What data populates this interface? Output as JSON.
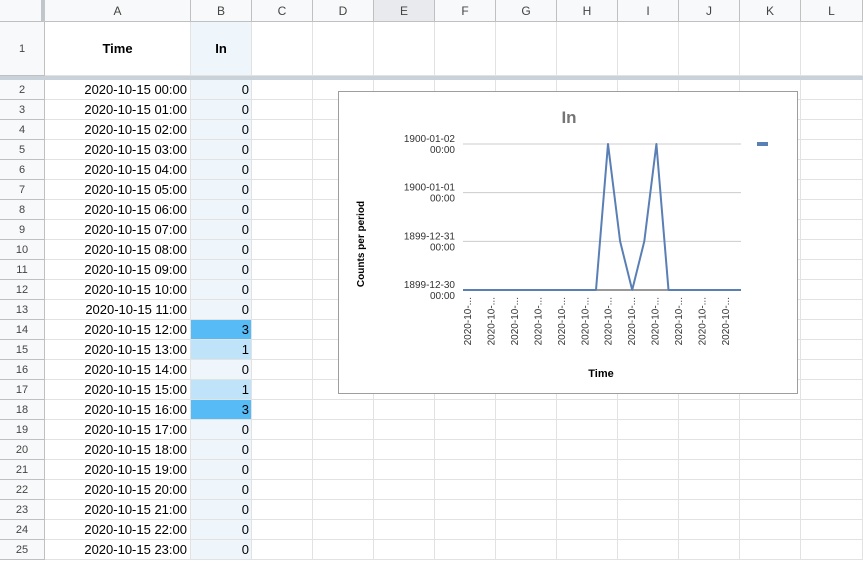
{
  "columns": [
    "A",
    "B",
    "C",
    "D",
    "E",
    "F",
    "G",
    "H",
    "I",
    "J",
    "K",
    "L"
  ],
  "header_row": {
    "row": "1",
    "time": "Time",
    "in": "In"
  },
  "rows": [
    {
      "row": "2",
      "time": "2020-10-15 00:00",
      "in": "0"
    },
    {
      "row": "3",
      "time": "2020-10-15 01:00",
      "in": "0"
    },
    {
      "row": "4",
      "time": "2020-10-15 02:00",
      "in": "0"
    },
    {
      "row": "5",
      "time": "2020-10-15 03:00",
      "in": "0"
    },
    {
      "row": "6",
      "time": "2020-10-15 04:00",
      "in": "0"
    },
    {
      "row": "7",
      "time": "2020-10-15 05:00",
      "in": "0"
    },
    {
      "row": "8",
      "time": "2020-10-15 06:00",
      "in": "0"
    },
    {
      "row": "9",
      "time": "2020-10-15 07:00",
      "in": "0"
    },
    {
      "row": "10",
      "time": "2020-10-15 08:00",
      "in": "0"
    },
    {
      "row": "11",
      "time": "2020-10-15 09:00",
      "in": "0"
    },
    {
      "row": "12",
      "time": "2020-10-15 10:00",
      "in": "0"
    },
    {
      "row": "13",
      "time": "2020-10-15 11:00",
      "in": "0"
    },
    {
      "row": "14",
      "time": "2020-10-15 12:00",
      "in": "3"
    },
    {
      "row": "15",
      "time": "2020-10-15 13:00",
      "in": "1"
    },
    {
      "row": "16",
      "time": "2020-10-15 14:00",
      "in": "0"
    },
    {
      "row": "17",
      "time": "2020-10-15 15:00",
      "in": "1"
    },
    {
      "row": "18",
      "time": "2020-10-15 16:00",
      "in": "3"
    },
    {
      "row": "19",
      "time": "2020-10-15 17:00",
      "in": "0"
    },
    {
      "row": "20",
      "time": "2020-10-15 18:00",
      "in": "0"
    },
    {
      "row": "21",
      "time": "2020-10-15 19:00",
      "in": "0"
    },
    {
      "row": "22",
      "time": "2020-10-15 20:00",
      "in": "0"
    },
    {
      "row": "23",
      "time": "2020-10-15 21:00",
      "in": "0"
    },
    {
      "row": "24",
      "time": "2020-10-15 22:00",
      "in": "0"
    },
    {
      "row": "25",
      "time": "2020-10-15 23:00",
      "in": "0"
    }
  ],
  "colors": {
    "col_b_bg": "#eef6fc",
    "heat_high": "#57bbf5",
    "heat_low": "#bfe3f9",
    "line": "#5a7fb5"
  },
  "chart_data": {
    "type": "line",
    "title": "In",
    "xlabel": "Time",
    "ylabel": "Counts per period",
    "y_ticks": [
      {
        "date": "1900-01-02",
        "time": "00:00"
      },
      {
        "date": "1900-01-01",
        "time": "00:00"
      },
      {
        "date": "1899-12-31",
        "time": "00:00"
      },
      {
        "date": "1899-12-30",
        "time": "00:00"
      }
    ],
    "x_tick_label": "2020-10-...",
    "x_tick_count": 12,
    "series": [
      {
        "values": [
          0,
          0,
          0,
          0,
          0,
          0,
          0,
          0,
          0,
          0,
          0,
          0,
          3,
          1,
          0,
          1,
          3,
          0,
          0,
          0,
          0,
          0,
          0,
          0
        ]
      }
    ],
    "ylim": [
      0,
      3
    ],
    "legend": "top-right",
    "grid": true
  }
}
